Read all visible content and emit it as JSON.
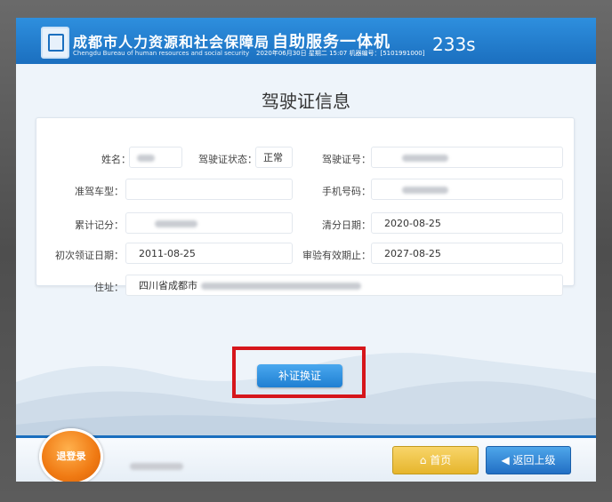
{
  "header": {
    "org_name": "成都市人力资源和社会保障局",
    "org_name_en": "Chengdu Bureau of human resources and social security",
    "kiosk_title": "自助服务一体机",
    "date_line": "2020年06月30日 星期二 15:07 机器编号：[5101991000]",
    "countdown": "233s"
  },
  "page": {
    "title": "驾驶证信息"
  },
  "form": {
    "name_label": "姓名：",
    "license_status_label": "驾驶证状态：",
    "license_status_value": "正常",
    "license_no_label": "驾驶证号：",
    "vehicle_type_label": "准驾车型：",
    "phone_label": "手机号码：",
    "points_label": "累计记分：",
    "clear_date_label": "清分日期：",
    "clear_date_value": "2020-08-25",
    "first_issue_label": "初次领证日期：",
    "first_issue_value": "2011-08-25",
    "valid_until_label": "审验有效期止：",
    "valid_until_value": "2027-08-25",
    "address_label": "住址：",
    "address_value": "四川省成都市"
  },
  "actions": {
    "replace_label": "补证换证",
    "logout_label": "退登录",
    "home_label": "首页",
    "back_label": "返回上级"
  },
  "colors": {
    "header": "#1b6fbf",
    "highlight": "#d6161b",
    "logout": "#f07a13",
    "home": "#e6b52c",
    "back": "#226fc4"
  }
}
